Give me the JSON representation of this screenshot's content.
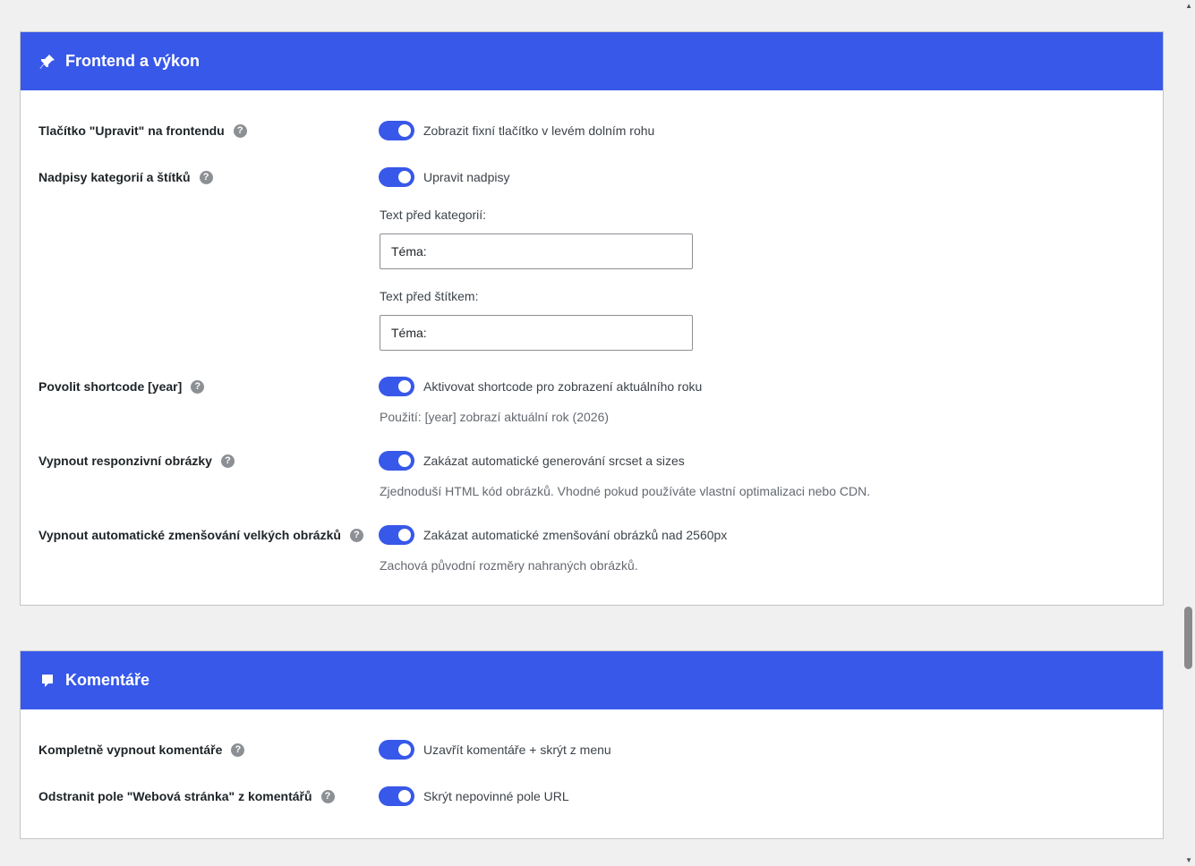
{
  "frontend": {
    "title": "Frontend a výkon",
    "icon": "pin-icon",
    "rows": [
      {
        "label": "Tlačítko \"Upravit\" na frontendu",
        "toggle_text": "Zobrazit fixní tlačítko v levém dolním rohu"
      },
      {
        "label": "Nadpisy kategorií a štítků",
        "toggle_text": "Upravit nadpisy"
      },
      {
        "label": "Povolit shortcode [year]",
        "toggle_text": "Aktivovat shortcode pro zobrazení aktuálního roku",
        "desc": "Použití: [year] zobrazí aktuální rok (2026)"
      },
      {
        "label": "Vypnout responzivní obrázky",
        "toggle_text": "Zakázat automatické generování srcset a sizes",
        "desc": "Zjednoduší HTML kód obrázků. Vhodné pokud používáte vlastní optimalizaci nebo CDN."
      },
      {
        "label": "Vypnout automatické zmenšování velkých obrázků",
        "toggle_text": "Zakázat automatické zmenšování obrázků nad 2560px",
        "desc": "Zachová původní rozměry nahraných obrázků."
      }
    ],
    "category_prefix": {
      "label": "Text před kategorií:",
      "value": "Téma:"
    },
    "tag_prefix": {
      "label": "Text před štítkem:",
      "value": "Téma:"
    }
  },
  "comments": {
    "title": "Komentáře",
    "icon": "comment-icon",
    "rows": [
      {
        "label": "Kompletně vypnout komentáře",
        "toggle_text": "Uzavřít komentáře + skrýt z menu"
      },
      {
        "label": "Odstranit pole \"Webová stránka\" z komentářů",
        "toggle_text": "Skrýt nepovinné pole URL"
      }
    ]
  },
  "help_glyph": "?",
  "colors": {
    "accent": "#3858e9",
    "background": "#f0f0f1"
  }
}
